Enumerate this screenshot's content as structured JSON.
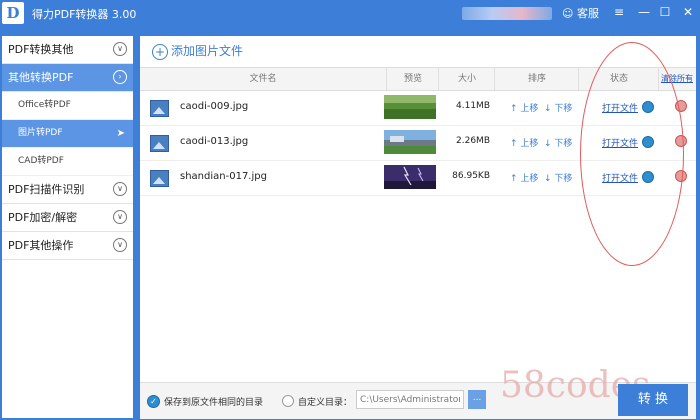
{
  "titlebar": {
    "logo_letter": "D",
    "title": "得力PDF转换器 3.00",
    "service_label": "客服",
    "service_icon": "headset-icon",
    "minimize": "—",
    "maximize": "☐",
    "close": "✕"
  },
  "sidebar": {
    "items": [
      {
        "label": "PDF转换其他",
        "chevron": "∨"
      },
      {
        "label": "其他转换PDF",
        "chevron": "›"
      },
      {
        "label": "PDF扫描件识别",
        "chevron": "∨"
      },
      {
        "label": "PDF加密/解密",
        "chevron": "∨"
      },
      {
        "label": "PDF其他操作",
        "chevron": "∨"
      }
    ],
    "sub_items": [
      {
        "label": "Office转PDF"
      },
      {
        "label": "图片转PDF"
      },
      {
        "label": "CAD转PDF"
      }
    ],
    "active_arrow": "➤"
  },
  "main": {
    "add_button": "添加图片文件",
    "clear_all": "清除所有",
    "columns": [
      "文件名",
      "预览",
      "大小",
      "排序",
      "状态"
    ],
    "rows": [
      {
        "name": "caodi-009.jpg",
        "size": "4.11MB",
        "up": "上移",
        "down": "下移",
        "status": "打开文件"
      },
      {
        "name": "caodi-013.jpg",
        "size": "2.26MB",
        "up": "上移",
        "down": "下移",
        "status": "打开文件"
      },
      {
        "name": "shandian-017.jpg",
        "size": "86.95KB",
        "up": "上移",
        "down": "下移",
        "status": "打开文件"
      }
    ]
  },
  "footer": {
    "save_same_dir": "保存到原文件相同的目录",
    "custom_dir": "自定义目录：",
    "path_value": "C:\\Users\\Administrator\\...",
    "browse": "...",
    "convert": "转 换"
  },
  "watermark": "58codes",
  "colors": {
    "accent": "#3d7fd8",
    "active": "#5b95e3",
    "highlight": "#e15a5a"
  }
}
